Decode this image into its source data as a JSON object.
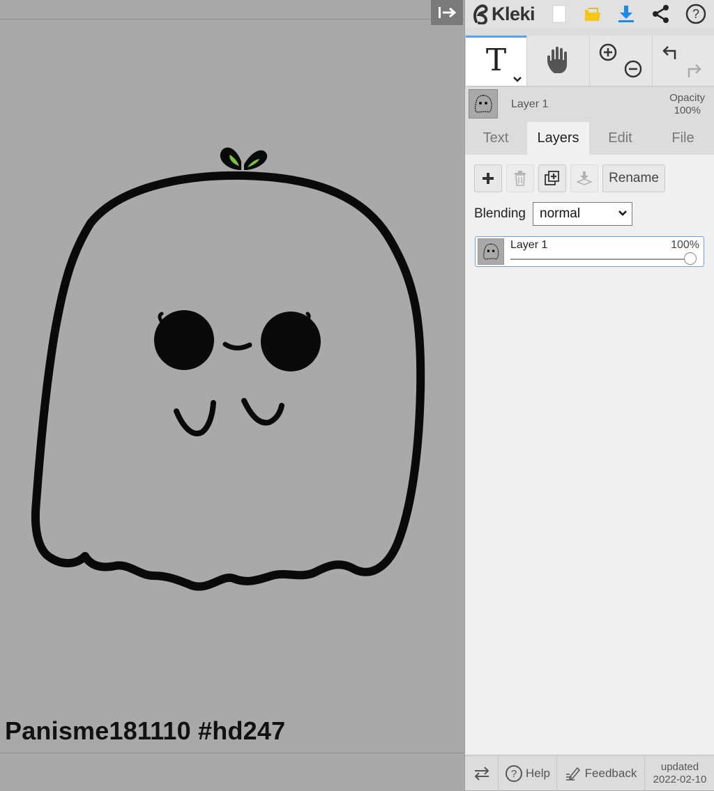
{
  "canvas": {
    "signature": "Panisme181110 #hd247",
    "background_color": "#a9a9a9",
    "stroke_color": "#0a0a0a",
    "sprout_color": "#7cc242"
  },
  "app": {
    "name": "Kleki"
  },
  "topbar_icons": [
    "new-image-icon",
    "open-folder-icon",
    "download-icon",
    "share-icon",
    "help-icon"
  ],
  "tools": {
    "text_tool_glyph": "T",
    "icons": [
      "text-tool-icon",
      "hand-icon",
      "zoom-in-icon",
      "zoom-out-icon",
      "undo-icon",
      "redo-icon"
    ]
  },
  "layer_preview": {
    "name": "Layer 1",
    "opacity_label": "Opacity",
    "opacity_value": "100%"
  },
  "tabs": [
    {
      "label": "Text",
      "active": false
    },
    {
      "label": "Layers",
      "active": true
    },
    {
      "label": "Edit",
      "active": false
    },
    {
      "label": "File",
      "active": false
    }
  ],
  "layers_panel": {
    "rename_label": "Rename",
    "blending_label": "Blending",
    "blending_value": "normal",
    "layers": [
      {
        "name": "Layer 1",
        "opacity_text": "100%",
        "opacity": 1.0
      }
    ]
  },
  "bottombar": {
    "help_label": "Help",
    "feedback_label": "Feedback",
    "updated_label": "updated",
    "updated_date": "2022-02-10"
  },
  "colors": {
    "accent": "#5aa0e6",
    "download_blue": "#1e88e5",
    "folder_yellow": "#f5c518"
  }
}
